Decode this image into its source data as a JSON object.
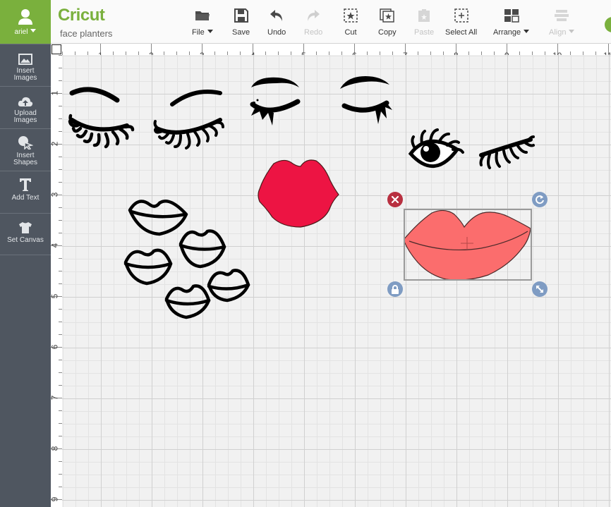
{
  "account": {
    "username": "ariel"
  },
  "sidebar": {
    "items": [
      {
        "label": "Insert Images",
        "icon": "image-icon"
      },
      {
        "label": "Upload Images",
        "icon": "cloud-upload-icon"
      },
      {
        "label": "Insert Shapes",
        "icon": "shapes-icon"
      },
      {
        "label": "Add Text",
        "icon": "text-icon"
      },
      {
        "label": "Set Canvas",
        "icon": "shirt-icon"
      }
    ]
  },
  "header": {
    "logo": "Cricut",
    "project_name": "face planters"
  },
  "toolbar": {
    "file": "File",
    "save": "Save",
    "undo": "Undo",
    "redo": "Redo",
    "cut": "Cut",
    "copy": "Copy",
    "paste": "Paste",
    "select_all": "Select All",
    "arrange": "Arrange",
    "align": "Align"
  },
  "ruler": {
    "horizontal": [
      "1",
      "2",
      "3",
      "4",
      "5",
      "6",
      "7",
      "8",
      "9",
      "10",
      "11"
    ],
    "vertical": [
      "1",
      "2",
      "3",
      "4",
      "5",
      "6",
      "7",
      "8",
      "9"
    ]
  },
  "colors": {
    "brand": "#7ab03d",
    "sidebar": "#4f5660",
    "red_lips": "#ed1443",
    "pink_lips": "#fb6d6d",
    "delete_handle": "#b83040",
    "handle": "#7f9cc3"
  },
  "selection": {
    "handles": [
      "delete-icon",
      "rotate-icon",
      "lock-icon",
      "resize-icon"
    ]
  }
}
